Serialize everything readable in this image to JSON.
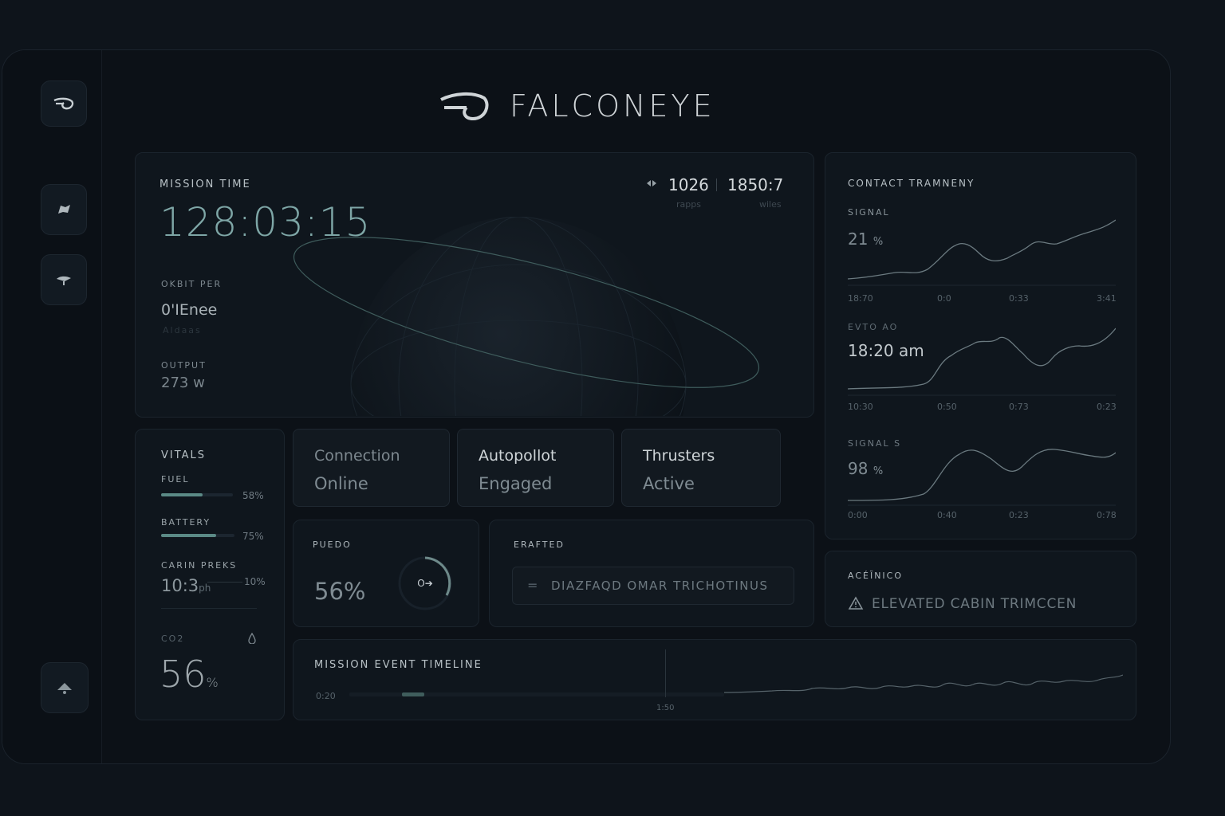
{
  "brand": {
    "name": "FALCONEYE"
  },
  "mission": {
    "label": "MISSION TIME",
    "time": "128:03:15",
    "stat_a": "1026",
    "stat_a_sub": "rapps",
    "stat_b": "1850:7",
    "stat_b_sub": "wiles",
    "orbit_label": "OKBIT PER",
    "orbit_value": "0'IEnee",
    "orbit_sub": "Aldaas",
    "output_label": "OUTPUT",
    "output_value": "273 w"
  },
  "vitals": {
    "title": "VITALS",
    "fuel_label": "FUEL",
    "fuel_pct": "58%",
    "fuel_level": 0.58,
    "battery_label": "BATTERY",
    "battery_pct": "75%",
    "battery_level": 0.75,
    "cabin_label": "CARIN PREKS",
    "cabin_value": "10:3",
    "cabin_unit": "ph",
    "cabin_pct": "10%",
    "co2_label": "CO2",
    "co2_value": "56",
    "co2_unit": "%"
  },
  "status": [
    {
      "title": "Connection",
      "value": "Online"
    },
    {
      "title": "Autopollot",
      "value": "Engaged"
    },
    {
      "title": "Thrusters",
      "value": "Active"
    }
  ],
  "puedo": {
    "label": "PUEDO",
    "value": "56%",
    "dial_text": "O➔"
  },
  "erafted": {
    "label": "ERAFTED",
    "icon": "equals-icon",
    "value": "DIAZFAQD OMAR TRICHOTINUS"
  },
  "telemetry": {
    "title": "CONTACT TRAMNENY",
    "charts": [
      {
        "label": "SIGNAL",
        "value": "21",
        "unit": "%",
        "ticks": [
          "18:70",
          "0:0",
          "0:33",
          "3:41"
        ]
      },
      {
        "label": "EVTO AO",
        "value": "18:20 am",
        "unit": "",
        "ticks": [
          "10:30",
          "0:50",
          "0:73",
          "0:23"
        ]
      },
      {
        "label": "SIGNAL S",
        "value": "98",
        "unit": "%",
        "ticks": [
          "0:00",
          "0:40",
          "0:23",
          "0:78"
        ]
      }
    ]
  },
  "alert": {
    "label": "ACÉĨNICO",
    "icon": "warning-icon",
    "text": "ELEVATED CABIN TRIMCCEN"
  },
  "timeline": {
    "title": "MISSION EVENT TIMELINE",
    "start": "0:20",
    "marker": "1:50"
  },
  "colors": {
    "accent": "#7ea6a6",
    "bar": "#5b8a86",
    "bg": "#0e141b",
    "panel": "#0f161d"
  }
}
